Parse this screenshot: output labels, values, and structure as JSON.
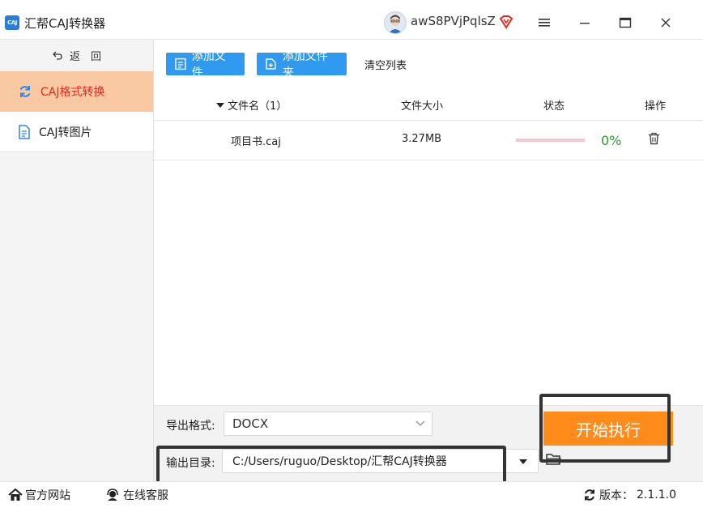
{
  "app": {
    "title": "汇帮CAJ转换器",
    "logo_text": "CAJ",
    "username": "awS8PVjPqlsZ"
  },
  "sidebar": {
    "back_label": "返　回",
    "items": [
      {
        "label": "CAJ格式转换",
        "active": true
      },
      {
        "label": "CAJ转图片",
        "active": false
      }
    ]
  },
  "toolbar": {
    "add_file": "添加文件",
    "add_folder": "添加文件夹",
    "clear_list": "清空列表"
  },
  "table": {
    "headers": {
      "name": "文件名（1）",
      "size": "文件大小",
      "status": "状态",
      "action": "操作"
    },
    "rows": [
      {
        "name": "项目书.caj",
        "size": "3.27MB",
        "progress": "0%"
      }
    ]
  },
  "export": {
    "format_label": "导出格式:",
    "format_value": "DOCX",
    "dir_label": "输出目录:",
    "dir_value": "C:/Users/ruguo/Desktop/汇帮CAJ转换器"
  },
  "start_label": "开始执行",
  "statusbar": {
    "website": "官方网站",
    "support": "在线客服",
    "version_label": "版本：",
    "version": "2.1.1.0"
  },
  "colors": {
    "accent_blue": "#2f9af0",
    "active_nav_bg": "#f8c9a3",
    "active_nav_text": "#e8271f",
    "start_button": "#ff8c1a",
    "progress_text": "#2aa02a"
  }
}
